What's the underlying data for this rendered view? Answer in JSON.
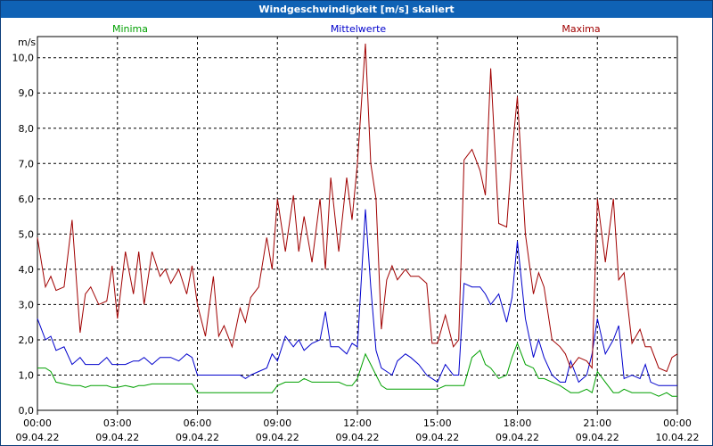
{
  "title": "Windgeschwindigkeit [m/s] skaliert",
  "ylabel": "m/s",
  "colors": {
    "titlebar": "#0f62b5",
    "minima": "#00a000",
    "mittel": "#0000cc",
    "maxima": "#a00000"
  },
  "chart_data": {
    "type": "line",
    "title": "Windgeschwindigkeit [m/s] skaliert",
    "ylabel": "m/s",
    "ylim": [
      0,
      10.6
    ],
    "xlim_hours": [
      0,
      24
    ],
    "grid": true,
    "legend_placement": "top",
    "yticks": [
      "0,0",
      "1,0",
      "2,0",
      "3,0",
      "4,0",
      "5,0",
      "6,0",
      "7,0",
      "8,0",
      "9,0",
      "10,0"
    ],
    "xticks": [
      {
        "time": "00:00",
        "date": "09.04.22"
      },
      {
        "time": "03:00",
        "date": "09.04.22"
      },
      {
        "time": "06:00",
        "date": "09.04.22"
      },
      {
        "time": "09:00",
        "date": "09.04.22"
      },
      {
        "time": "12:00",
        "date": "09.04.22"
      },
      {
        "time": "15:00",
        "date": "09.04.22"
      },
      {
        "time": "18:00",
        "date": "09.04.22"
      },
      {
        "time": "21:00",
        "date": "09.04.22"
      },
      {
        "time": "00:00",
        "date": "10.04.22"
      }
    ],
    "series": [
      {
        "name": "Minima",
        "color": "#00a000",
        "x": [
          0,
          0.3,
          0.5,
          0.7,
          1.0,
          1.3,
          1.6,
          1.8,
          2.0,
          2.3,
          2.6,
          2.8,
          3.0,
          3.3,
          3.6,
          3.8,
          4.0,
          4.3,
          4.6,
          4.8,
          5.0,
          5.3,
          5.6,
          5.8,
          6.0,
          6.3,
          6.6,
          6.8,
          7.0,
          7.3,
          7.6,
          7.8,
          8.0,
          8.3,
          8.6,
          8.8,
          9.0,
          9.3,
          9.6,
          9.8,
          10.0,
          10.3,
          10.6,
          10.8,
          11.0,
          11.3,
          11.6,
          11.8,
          12.0,
          12.3,
          12.5,
          12.7,
          12.9,
          13.1,
          13.3,
          13.5,
          13.8,
          14.0,
          14.3,
          14.6,
          14.8,
          15.0,
          15.3,
          15.6,
          15.8,
          16.0,
          16.3,
          16.6,
          16.8,
          17.0,
          17.3,
          17.6,
          17.8,
          18.0,
          18.3,
          18.6,
          18.8,
          19.0,
          19.3,
          19.6,
          19.8,
          20.0,
          20.3,
          20.6,
          20.8,
          21.0,
          21.3,
          21.6,
          21.8,
          22.0,
          22.3,
          22.6,
          22.8,
          23.0,
          23.3,
          23.6,
          23.8,
          24.0
        ],
        "values": [
          1.2,
          1.2,
          1.1,
          0.8,
          0.75,
          0.7,
          0.7,
          0.65,
          0.7,
          0.7,
          0.7,
          0.65,
          0.65,
          0.7,
          0.65,
          0.7,
          0.7,
          0.75,
          0.75,
          0.75,
          0.75,
          0.75,
          0.75,
          0.75,
          0.5,
          0.5,
          0.5,
          0.5,
          0.5,
          0.5,
          0.5,
          0.5,
          0.5,
          0.5,
          0.5,
          0.5,
          0.7,
          0.8,
          0.8,
          0.8,
          0.9,
          0.8,
          0.8,
          0.8,
          0.8,
          0.8,
          0.7,
          0.7,
          0.9,
          1.6,
          1.3,
          1.0,
          0.7,
          0.6,
          0.6,
          0.6,
          0.6,
          0.6,
          0.6,
          0.6,
          0.6,
          0.6,
          0.7,
          0.7,
          0.7,
          0.7,
          1.5,
          1.7,
          1.3,
          1.2,
          0.9,
          1.0,
          1.5,
          1.9,
          1.3,
          1.2,
          0.9,
          0.9,
          0.8,
          0.7,
          0.6,
          0.5,
          0.5,
          0.6,
          0.5,
          1.1,
          0.8,
          0.5,
          0.5,
          0.6,
          0.5,
          0.5,
          0.5,
          0.5,
          0.4,
          0.5,
          0.4,
          0.4
        ]
      },
      {
        "name": "Mittelwerte",
        "color": "#0000cc",
        "x": [
          0,
          0.3,
          0.5,
          0.7,
          1.0,
          1.3,
          1.6,
          1.8,
          2.0,
          2.3,
          2.6,
          2.8,
          3.0,
          3.3,
          3.6,
          3.8,
          4.0,
          4.3,
          4.6,
          4.8,
          5.0,
          5.3,
          5.6,
          5.8,
          6.0,
          6.3,
          6.6,
          6.8,
          7.0,
          7.3,
          7.6,
          7.8,
          8.0,
          8.3,
          8.6,
          8.8,
          9.0,
          9.3,
          9.6,
          9.8,
          10.0,
          10.3,
          10.6,
          10.8,
          11.0,
          11.3,
          11.6,
          11.8,
          12.0,
          12.3,
          12.5,
          12.7,
          12.9,
          13.1,
          13.3,
          13.5,
          13.8,
          14.0,
          14.3,
          14.6,
          14.8,
          15.0,
          15.3,
          15.6,
          15.8,
          16.0,
          16.3,
          16.6,
          16.8,
          17.0,
          17.3,
          17.6,
          17.8,
          18.0,
          18.3,
          18.6,
          18.8,
          19.0,
          19.3,
          19.6,
          19.8,
          20.0,
          20.3,
          20.6,
          20.8,
          21.0,
          21.3,
          21.6,
          21.8,
          22.0,
          22.3,
          22.6,
          22.8,
          23.0,
          23.3,
          23.6,
          23.8,
          24.0
        ],
        "values": [
          2.6,
          2.0,
          2.1,
          1.7,
          1.8,
          1.3,
          1.5,
          1.3,
          1.3,
          1.3,
          1.5,
          1.3,
          1.3,
          1.3,
          1.4,
          1.4,
          1.5,
          1.3,
          1.5,
          1.5,
          1.5,
          1.4,
          1.6,
          1.5,
          1.0,
          1.0,
          1.0,
          1.0,
          1.0,
          1.0,
          1.0,
          0.9,
          1.0,
          1.1,
          1.2,
          1.6,
          1.4,
          2.1,
          1.8,
          2.0,
          1.7,
          1.9,
          2.0,
          2.8,
          1.8,
          1.8,
          1.6,
          1.9,
          1.8,
          5.7,
          3.5,
          1.7,
          1.2,
          1.1,
          1.0,
          1.4,
          1.6,
          1.5,
          1.3,
          1.0,
          0.9,
          0.8,
          1.3,
          1.0,
          1.0,
          3.6,
          3.5,
          3.5,
          3.3,
          3.0,
          3.3,
          2.5,
          3.2,
          4.8,
          2.6,
          1.5,
          2.0,
          1.5,
          1.0,
          0.8,
          0.8,
          1.4,
          0.8,
          1.0,
          1.6,
          2.6,
          1.6,
          2.0,
          2.4,
          0.9,
          1.0,
          0.9,
          1.3,
          0.8,
          0.7,
          0.7,
          0.7,
          0.7
        ]
      },
      {
        "name": "Maxima",
        "color": "#a00000",
        "x": [
          0,
          0.3,
          0.5,
          0.7,
          1.0,
          1.3,
          1.6,
          1.8,
          2.0,
          2.3,
          2.6,
          2.8,
          3.0,
          3.3,
          3.6,
          3.8,
          4.0,
          4.3,
          4.6,
          4.8,
          5.0,
          5.3,
          5.6,
          5.8,
          6.0,
          6.3,
          6.6,
          6.8,
          7.0,
          7.3,
          7.6,
          7.8,
          8.0,
          8.3,
          8.6,
          8.8,
          9.0,
          9.3,
          9.6,
          9.8,
          10.0,
          10.3,
          10.6,
          10.8,
          11.0,
          11.3,
          11.6,
          11.8,
          12.0,
          12.3,
          12.5,
          12.7,
          12.9,
          13.1,
          13.3,
          13.5,
          13.8,
          14.0,
          14.3,
          14.6,
          14.8,
          15.0,
          15.3,
          15.6,
          15.8,
          16.0,
          16.3,
          16.6,
          16.8,
          17.0,
          17.3,
          17.6,
          17.8,
          18.0,
          18.3,
          18.6,
          18.8,
          19.0,
          19.3,
          19.6,
          19.8,
          20.0,
          20.3,
          20.6,
          20.8,
          21.0,
          21.3,
          21.6,
          21.8,
          22.0,
          22.3,
          22.6,
          22.8,
          23.0,
          23.3,
          23.6,
          23.8,
          24.0
        ],
        "values": [
          4.9,
          3.5,
          3.8,
          3.4,
          3.5,
          5.4,
          2.2,
          3.3,
          3.5,
          3.0,
          3.1,
          4.1,
          2.6,
          4.5,
          3.3,
          4.5,
          3.0,
          4.5,
          3.8,
          4.0,
          3.6,
          4.0,
          3.3,
          4.1,
          3.0,
          2.1,
          3.8,
          2.1,
          2.4,
          1.8,
          2.9,
          2.5,
          3.2,
          3.5,
          4.9,
          4.0,
          6.0,
          4.5,
          6.1,
          4.5,
          5.5,
          4.2,
          6.0,
          4.0,
          6.6,
          4.5,
          6.6,
          5.4,
          7.0,
          10.4,
          7.0,
          6.0,
          2.3,
          3.7,
          4.1,
          3.7,
          4.0,
          3.8,
          3.8,
          3.6,
          1.9,
          1.9,
          2.7,
          1.8,
          2.0,
          7.1,
          7.4,
          6.8,
          6.1,
          9.7,
          5.3,
          5.2,
          7.3,
          8.9,
          5.0,
          3.3,
          3.9,
          3.5,
          2.0,
          1.8,
          1.6,
          1.2,
          1.5,
          1.4,
          1.2,
          6.0,
          4.2,
          6.0,
          3.7,
          3.9,
          1.9,
          2.3,
          1.8,
          1.8,
          1.2,
          1.1,
          1.5,
          1.6
        ]
      }
    ]
  }
}
